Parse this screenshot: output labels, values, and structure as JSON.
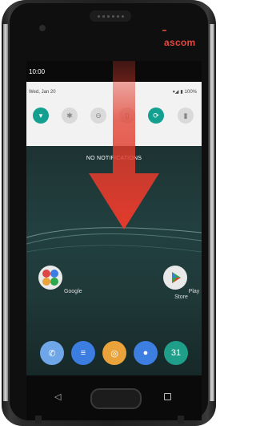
{
  "device": {
    "brand": "ascom"
  },
  "status_bar": {
    "time": "10:00"
  },
  "quick_settings": {
    "date": "Wed, Jan 20",
    "battery": "100%",
    "tiles": [
      {
        "name": "wifi-icon",
        "glyph": "▾",
        "active": true
      },
      {
        "name": "bluetooth-icon",
        "glyph": "✱",
        "active": false
      },
      {
        "name": "do-not-disturb-icon",
        "glyph": "⊖",
        "active": false
      },
      {
        "name": "flashlight-icon",
        "glyph": "▯",
        "active": false
      },
      {
        "name": "auto-rotate-icon",
        "glyph": "⟳",
        "active": true
      },
      {
        "name": "battery-saver-icon",
        "glyph": "▮",
        "active": false
      }
    ]
  },
  "notifications": {
    "empty_label": "NO NOTIFICATIONS"
  },
  "home": {
    "apps": [
      {
        "label": "Google"
      },
      {
        "label": "Play Store"
      }
    ],
    "dock": [
      {
        "name": "phone-app-icon",
        "color": "#6ea6e8",
        "glyph": "✆"
      },
      {
        "name": "messages-app-icon",
        "color": "#3b7de0",
        "glyph": "≡"
      },
      {
        "name": "chrome-app-icon",
        "color": "#e9a33a",
        "glyph": "◎"
      },
      {
        "name": "contacts-app-icon",
        "color": "#3d7fe0",
        "glyph": "●"
      },
      {
        "name": "calendar-app-icon",
        "color": "#1f9e8a",
        "glyph": "31"
      }
    ]
  },
  "colors": {
    "accent": "#14a091",
    "arrow": "#e23b2c",
    "brand": "#e8463c"
  }
}
